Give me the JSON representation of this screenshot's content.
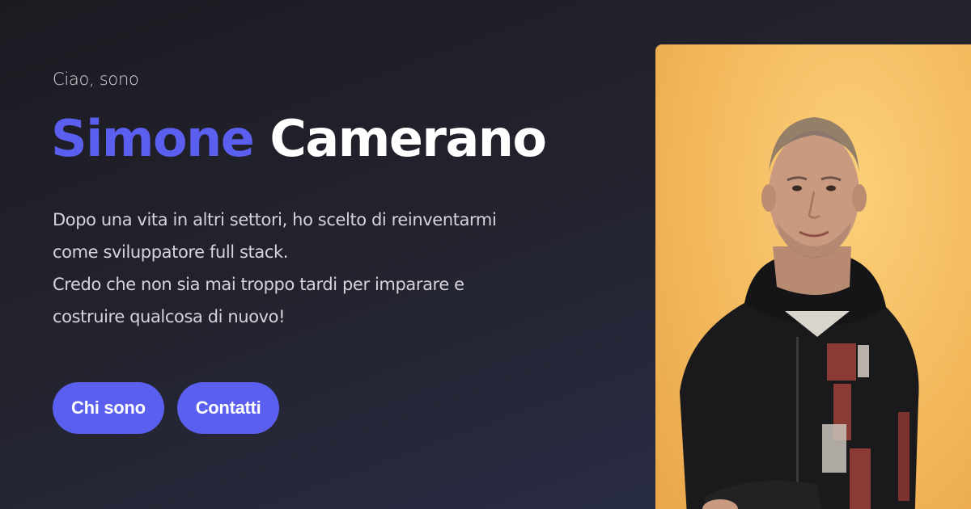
{
  "hero": {
    "intro": "Ciao, sono",
    "name_first": "Simone",
    "name_last": "Camerano",
    "bio_line1": "Dopo una vita in altri settori, ho scelto di reinventarmi come sviluppatore full stack.",
    "bio_line2": "Credo che non sia mai troppo tardi per imparare e costruire qualcosa di nuovo!",
    "buttons": [
      {
        "label": "Chi sono"
      },
      {
        "label": "Contatti"
      }
    ]
  },
  "colors": {
    "accent": "#5b5ff0",
    "background": "#1f1f27",
    "photo_background": "#f4b85c"
  }
}
